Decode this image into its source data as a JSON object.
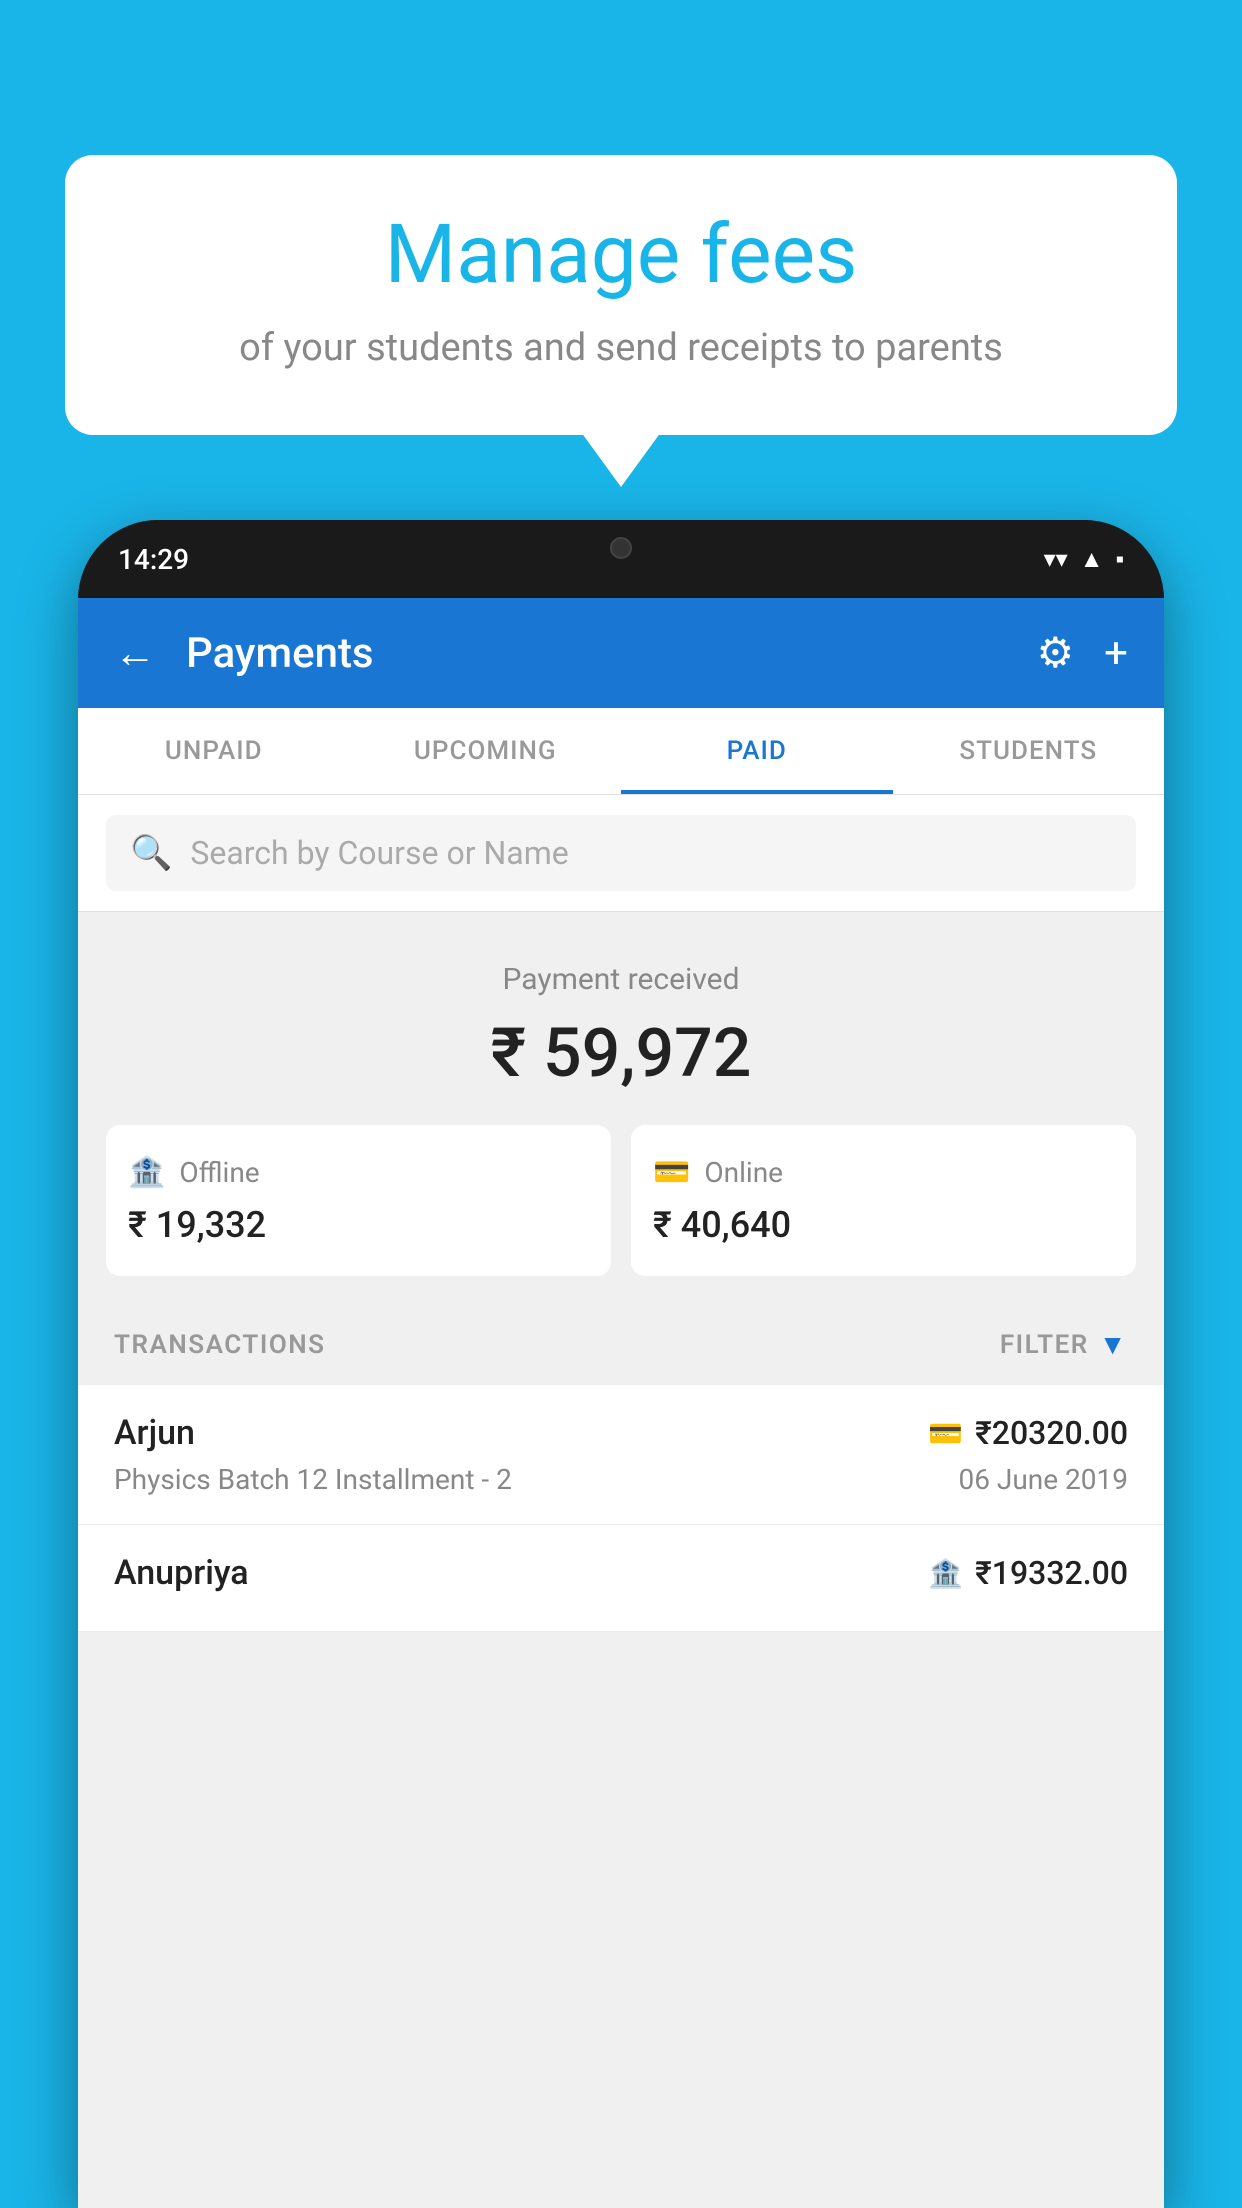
{
  "bubble": {
    "title": "Manage fees",
    "subtitle": "of your students and send receipts to parents"
  },
  "status_bar": {
    "time": "14:29",
    "wifi": "▲",
    "signal": "▲",
    "battery": "▪"
  },
  "header": {
    "title": "Payments",
    "back_label": "←",
    "settings_label": "⚙",
    "add_label": "+"
  },
  "tabs": [
    {
      "label": "UNPAID",
      "active": false
    },
    {
      "label": "UPCOMING",
      "active": false
    },
    {
      "label": "PAID",
      "active": true
    },
    {
      "label": "STUDENTS",
      "active": false
    }
  ],
  "search": {
    "placeholder": "Search by Course or Name"
  },
  "payment": {
    "label": "Payment received",
    "total": "₹ 59,972",
    "offline_label": "Offline",
    "offline_amount": "₹ 19,332",
    "online_label": "Online",
    "online_amount": "₹ 40,640"
  },
  "transactions": {
    "label": "TRANSACTIONS",
    "filter_label": "FILTER",
    "rows": [
      {
        "name": "Arjun",
        "course": "Physics Batch 12 Installment - 2",
        "amount": "₹20320.00",
        "date": "06 June 2019",
        "type": "online"
      },
      {
        "name": "Anupriya",
        "course": "",
        "amount": "₹19332.00",
        "date": "",
        "type": "offline"
      }
    ]
  }
}
